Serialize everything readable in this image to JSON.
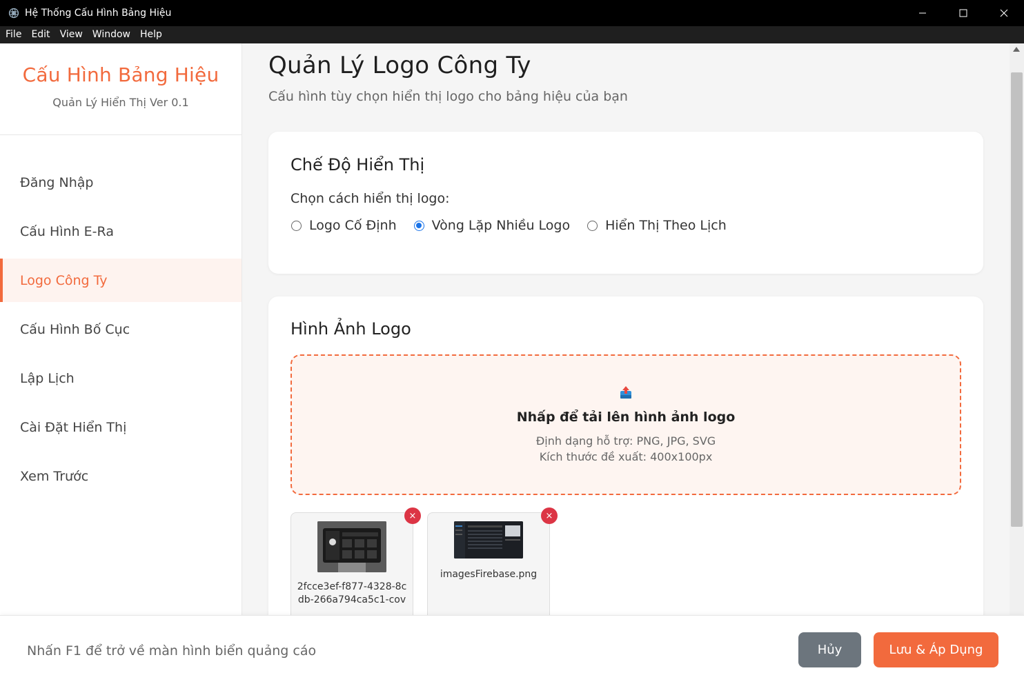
{
  "window": {
    "title": "Hệ Thống Cấu Hình Bảng Hiệu",
    "controls": [
      "minimize-icon",
      "maximize-icon",
      "close-icon"
    ]
  },
  "menu": [
    "File",
    "Edit",
    "View",
    "Window",
    "Help"
  ],
  "sidebar": {
    "brand_title": "Cấu Hình Bảng Hiệu",
    "brand_sub": "Quản Lý Hiển Thị Ver 0.1",
    "items": [
      {
        "label": "Đăng Nhập",
        "active": false
      },
      {
        "label": "Cấu Hình E-Ra",
        "active": false
      },
      {
        "label": "Logo Công Ty",
        "active": true
      },
      {
        "label": "Cấu Hình Bố Cục",
        "active": false
      },
      {
        "label": "Lập Lịch",
        "active": false
      },
      {
        "label": "Cài Đặt Hiển Thị",
        "active": false
      },
      {
        "label": "Xem Trước",
        "active": false
      }
    ]
  },
  "page": {
    "title": "Quản Lý Logo Công Ty",
    "subtitle": "Cấu hình tùy chọn hiển thị logo cho bảng hiệu của bạn"
  },
  "display_mode": {
    "title": "Chế Độ Hiển Thị",
    "prompt": "Chọn cách hiển thị logo:",
    "options": [
      {
        "label": "Logo Cố Định",
        "checked": false
      },
      {
        "label": "Vòng Lặp Nhiều Logo",
        "checked": true
      },
      {
        "label": "Hiển Thị Theo Lịch",
        "checked": false
      }
    ]
  },
  "logo_images": {
    "title": "Hình Ảnh Logo",
    "dropzone": {
      "title": "Nhấp để tải lên hình ảnh logo",
      "formats": "Định dạng hỗ trợ: PNG, JPG, SVG",
      "size": "Kích thước đề xuất: 400x100px"
    },
    "files": [
      {
        "name": "2fcce3ef-f877-4328-8cdb-266a794ca5c1-cov",
        "remove": "×"
      },
      {
        "name": "imagesFirebase.png",
        "remove": "×"
      }
    ]
  },
  "footer": {
    "hint": "Nhấn F1 để trở về màn hình biển quảng cáo",
    "cancel": "Hủy",
    "save": "Lưu & Áp Dụng"
  },
  "colors": {
    "accent": "#f26a3d",
    "radio": "#1a73e8",
    "danger": "#dc3545",
    "secondary": "#6c757d"
  }
}
